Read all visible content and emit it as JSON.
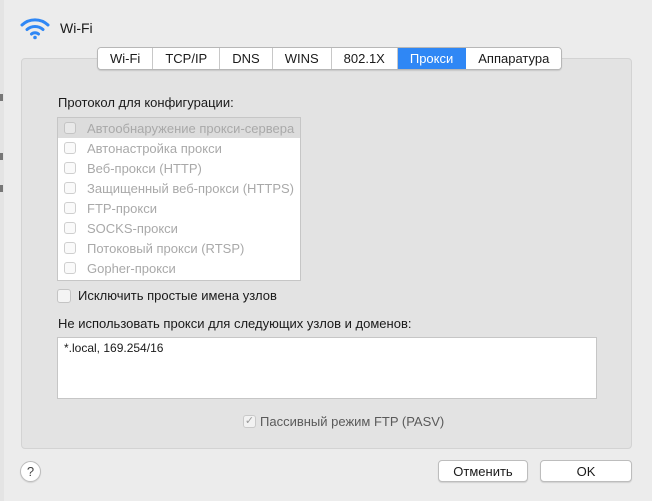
{
  "window": {
    "title": "Wi-Fi"
  },
  "tabs": [
    {
      "label": "Wi-Fi",
      "active": false
    },
    {
      "label": "TCP/IP",
      "active": false
    },
    {
      "label": "DNS",
      "active": false
    },
    {
      "label": "WINS",
      "active": false
    },
    {
      "label": "802.1X",
      "active": false
    },
    {
      "label": "Прокси",
      "active": true
    },
    {
      "label": "Аппаратура",
      "active": false
    }
  ],
  "proxy": {
    "protocols_label": "Протокол для конфигурации:",
    "protocols": [
      {
        "label": "Автообнаружение прокси-сервера",
        "checked": false
      },
      {
        "label": "Автонастройка прокси",
        "checked": false
      },
      {
        "label": "Веб-прокси (HTTP)",
        "checked": false
      },
      {
        "label": "Защищенный веб-прокси (HTTPS)",
        "checked": false
      },
      {
        "label": "FTP-прокси",
        "checked": false
      },
      {
        "label": "SOCKS-прокси",
        "checked": false
      },
      {
        "label": "Потоковый прокси (RTSP)",
        "checked": false
      },
      {
        "label": "Gopher-прокси",
        "checked": false
      }
    ],
    "exclude_simple_label": "Исключить простые имена узлов",
    "exclude_simple_checked": false,
    "bypass_label": "Не использовать прокси для следующих узлов и доменов:",
    "bypass_value": "*.local, 169.254/16",
    "pasv_label": "Пассивный режим FTP (PASV)",
    "pasv_checked": true
  },
  "footer": {
    "help_label": "?",
    "cancel_label": "Отменить",
    "ok_label": "OK"
  },
  "colors": {
    "accent": "#2f87f5",
    "wifi_icon": "#2f87f5"
  }
}
